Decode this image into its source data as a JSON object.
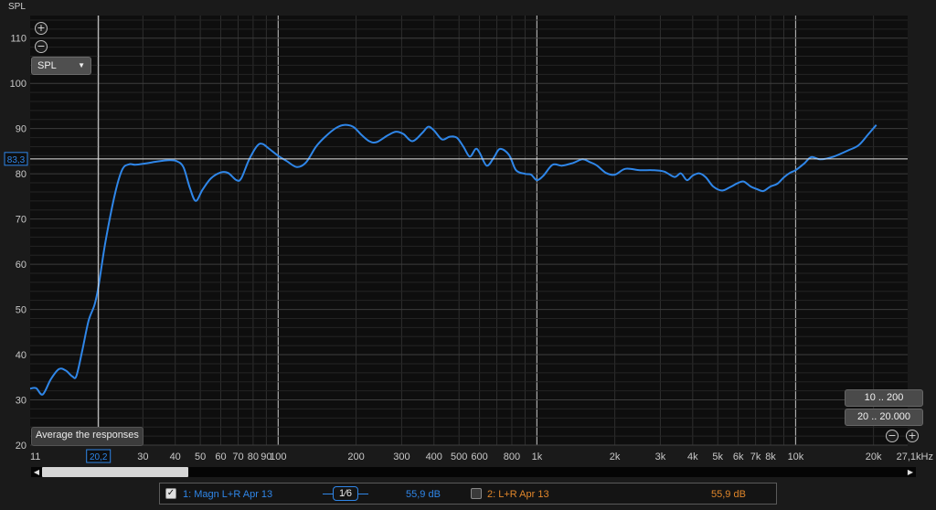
{
  "chart_data": {
    "type": "line",
    "ylabel": "SPL",
    "x_scale": "log",
    "xlim": [
      11,
      27100
    ],
    "ylim": [
      20,
      115
    ],
    "grid": true,
    "y_ticks": [
      20,
      30,
      40,
      50,
      60,
      70,
      80,
      90,
      100,
      110
    ],
    "x_ticks": [
      {
        "v": 11,
        "label": "11"
      },
      {
        "v": 30,
        "label": "30"
      },
      {
        "v": 40,
        "label": "40"
      },
      {
        "v": 50,
        "label": "50"
      },
      {
        "v": 60,
        "label": "60"
      },
      {
        "v": 70,
        "label": "70"
      },
      {
        "v": 80,
        "label": "80"
      },
      {
        "v": 90,
        "label": "90"
      },
      {
        "v": 100,
        "label": "100"
      },
      {
        "v": 200,
        "label": "200"
      },
      {
        "v": 300,
        "label": "300"
      },
      {
        "v": 400,
        "label": "400"
      },
      {
        "v": 500,
        "label": "500"
      },
      {
        "v": 600,
        "label": "600"
      },
      {
        "v": 800,
        "label": "800"
      },
      {
        "v": 1000,
        "label": "1k"
      },
      {
        "v": 2000,
        "label": "2k"
      },
      {
        "v": 3000,
        "label": "3k"
      },
      {
        "v": 4000,
        "label": "4k"
      },
      {
        "v": 5000,
        "label": "5k"
      },
      {
        "v": 6000,
        "label": "6k"
      },
      {
        "v": 7000,
        "label": "7k"
      },
      {
        "v": 8000,
        "label": "8k"
      },
      {
        "v": 10000,
        "label": "10k"
      },
      {
        "v": 20000,
        "label": "20k"
      },
      {
        "v": 27100,
        "label": "27,1kHz"
      }
    ],
    "cursor": {
      "x": 20.2,
      "x_label": "20,2",
      "y": 83.3,
      "y_label": "83,3"
    },
    "series": [
      {
        "name": "1: Magn L+R Apr 13",
        "color": "#2f86e8",
        "points": [
          [
            11,
            32.5
          ],
          [
            11.6,
            32.6
          ],
          [
            12.3,
            31.2
          ],
          [
            13.2,
            34.5
          ],
          [
            14.2,
            36.8
          ],
          [
            15.1,
            36.5
          ],
          [
            16,
            35.2
          ],
          [
            16.6,
            35.3
          ],
          [
            17.5,
            41
          ],
          [
            18.5,
            47.5
          ],
          [
            19.5,
            51
          ],
          [
            20.2,
            55
          ],
          [
            21.5,
            65
          ],
          [
            23.5,
            76
          ],
          [
            25,
            81
          ],
          [
            26.5,
            82.1
          ],
          [
            28,
            82
          ],
          [
            30,
            82.2
          ],
          [
            34,
            82.7
          ],
          [
            38,
            83
          ],
          [
            40.5,
            82.8
          ],
          [
            43,
            81.5
          ],
          [
            45.5,
            77
          ],
          [
            48,
            74
          ],
          [
            51,
            76.5
          ],
          [
            55,
            79
          ],
          [
            60,
            80.3
          ],
          [
            64,
            80.2
          ],
          [
            69,
            78.6
          ],
          [
            72,
            79
          ],
          [
            77,
            83
          ],
          [
            83,
            86.2
          ],
          [
            87,
            86.6
          ],
          [
            92,
            85.6
          ],
          [
            100,
            84
          ],
          [
            108,
            82.8
          ],
          [
            118,
            81.5
          ],
          [
            128,
            82.5
          ],
          [
            140,
            86
          ],
          [
            152,
            88.2
          ],
          [
            168,
            90.2
          ],
          [
            180,
            90.8
          ],
          [
            195,
            90.4
          ],
          [
            210,
            88.6
          ],
          [
            225,
            87.2
          ],
          [
            240,
            87
          ],
          [
            265,
            88.5
          ],
          [
            285,
            89.3
          ],
          [
            305,
            88.8
          ],
          [
            330,
            87.2
          ],
          [
            360,
            89
          ],
          [
            380,
            90.4
          ],
          [
            400,
            89.6
          ],
          [
            430,
            87.6
          ],
          [
            460,
            88.2
          ],
          [
            490,
            88
          ],
          [
            520,
            86
          ],
          [
            550,
            83.8
          ],
          [
            580,
            85.5
          ],
          [
            600,
            84.7
          ],
          [
            640,
            81.8
          ],
          [
            680,
            83.5
          ],
          [
            720,
            85.5
          ],
          [
            780,
            84.2
          ],
          [
            830,
            80.8
          ],
          [
            900,
            80
          ],
          [
            950,
            79.8
          ],
          [
            1000,
            78.6
          ],
          [
            1060,
            79.6
          ],
          [
            1150,
            82
          ],
          [
            1250,
            81.8
          ],
          [
            1380,
            82.4
          ],
          [
            1500,
            83.2
          ],
          [
            1600,
            82.6
          ],
          [
            1700,
            81.9
          ],
          [
            1850,
            80.2
          ],
          [
            2000,
            79.8
          ],
          [
            2200,
            81.1
          ],
          [
            2500,
            80.8
          ],
          [
            2800,
            80.8
          ],
          [
            3100,
            80.5
          ],
          [
            3400,
            79.3
          ],
          [
            3600,
            80.1
          ],
          [
            3800,
            78.6
          ],
          [
            4000,
            79.6
          ],
          [
            4250,
            80.1
          ],
          [
            4500,
            79.2
          ],
          [
            4800,
            77.2
          ],
          [
            5200,
            76.3
          ],
          [
            5600,
            77.1
          ],
          [
            6000,
            78
          ],
          [
            6300,
            78.3
          ],
          [
            6700,
            77.2
          ],
          [
            7100,
            76.6
          ],
          [
            7500,
            76.2
          ],
          [
            8000,
            77.2
          ],
          [
            8500,
            77.8
          ],
          [
            9000,
            79.2
          ],
          [
            9500,
            80.2
          ],
          [
            10000,
            80.8
          ],
          [
            10800,
            82.3
          ],
          [
            11500,
            83.7
          ],
          [
            12500,
            83.2
          ],
          [
            14000,
            83.8
          ],
          [
            16000,
            85.2
          ],
          [
            17500,
            86.3
          ],
          [
            19000,
            88.6
          ],
          [
            20500,
            90.8
          ]
        ]
      }
    ]
  },
  "axis": {
    "title": "SPL"
  },
  "controls": {
    "zoom_in_symbol": "+",
    "zoom_out_symbol": "−",
    "view_dropdown": {
      "label": "SPL",
      "arrow": "▼"
    },
    "range_buttons": [
      "10 .. 200",
      "20 .. 20.000"
    ],
    "average_button": "Average the responses"
  },
  "scrollbar": {
    "left_arrow": "◀",
    "right_arrow": "▶"
  },
  "legend": {
    "items": [
      {
        "checked": true,
        "check_mark": "✓",
        "label": "1: Magn L+R Apr 13",
        "smoothing": "1⁄6",
        "level": "55,9 dB"
      },
      {
        "checked": false,
        "label": "2: L+R Apr 13",
        "level": "55,9 dB"
      }
    ]
  },
  "colors": {
    "trace": "#2f86e8",
    "trace2": "#e0862a",
    "cursor": "#e6e6e6",
    "grid_major": "#3a3a3a",
    "grid_minor": "#262626"
  }
}
